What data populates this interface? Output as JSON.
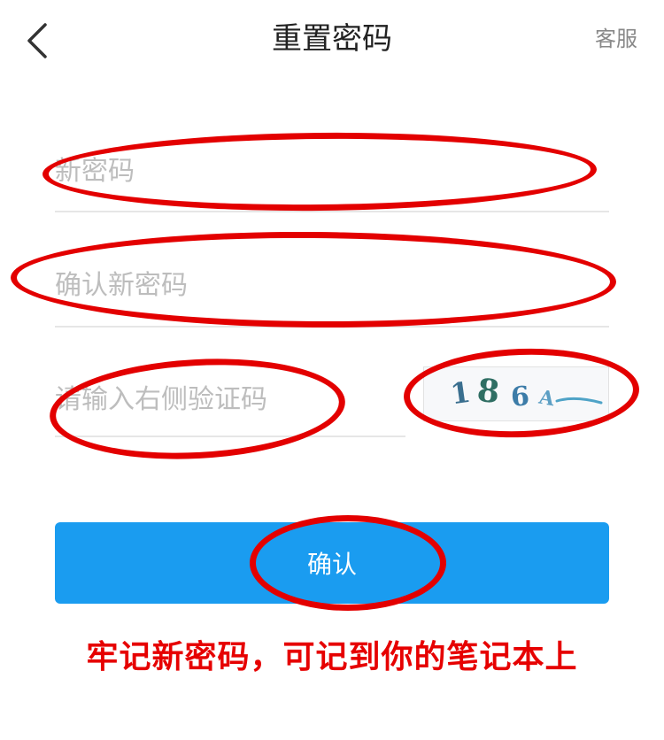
{
  "header": {
    "title": "重置密码",
    "service_label": "客服",
    "back_icon": "chevron-left-icon"
  },
  "form": {
    "new_password": {
      "placeholder": "新密码",
      "value": ""
    },
    "confirm_password": {
      "placeholder": "确认新密码",
      "value": ""
    },
    "captcha_input": {
      "placeholder": "请输入右侧验证码",
      "value": ""
    },
    "captcha_image": {
      "chars": [
        "1",
        "8",
        "6",
        "A"
      ]
    }
  },
  "confirm_button": {
    "label": "确认"
  },
  "annotation": {
    "note": "牢记新密码，可记到你的笔记本上",
    "color": "#e60000"
  },
  "colors": {
    "primary": "#1a9cf0",
    "annotation_ring": "#e30000"
  }
}
